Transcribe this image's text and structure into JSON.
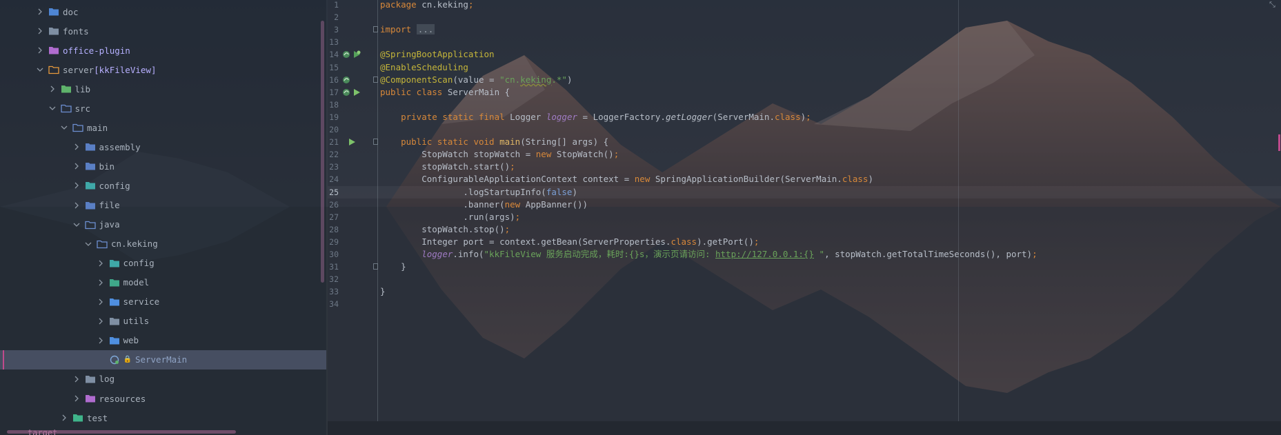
{
  "project_tree": {
    "rows": [
      {
        "label": "doc",
        "depth": 2,
        "chevron": "right",
        "icon": "folder-doc-icon",
        "color": "#4e86d4"
      },
      {
        "label": "fonts",
        "depth": 2,
        "chevron": "right",
        "icon": "folder-fonts-icon",
        "color": "#7f8fa3"
      },
      {
        "label": "office-plugin",
        "depth": 2,
        "chevron": "right",
        "icon": "folder-icon",
        "color": "#b06ccf"
      },
      {
        "label": "server",
        "module": "[kkFileView]",
        "depth": 2,
        "chevron": "down",
        "icon": "module-folder-icon",
        "color": "#e89a3c"
      },
      {
        "label": "lib",
        "depth": 3,
        "chevron": "right",
        "icon": "library-folder-icon",
        "color": "#5fb36b"
      },
      {
        "label": "src",
        "depth": 3,
        "chevron": "down",
        "icon": "source-folder-icon",
        "color": "#6d8fd1"
      },
      {
        "label": "main",
        "depth": 4,
        "chevron": "down",
        "icon": "folder-open-icon",
        "color": "#6d8fd1"
      },
      {
        "label": "assembly",
        "depth": 5,
        "chevron": "right",
        "icon": "folder-icon",
        "color": "#5a7fc4"
      },
      {
        "label": "bin",
        "depth": 5,
        "chevron": "right",
        "icon": "folder-icon",
        "color": "#5a7fc4"
      },
      {
        "label": "config",
        "depth": 5,
        "chevron": "right",
        "icon": "config-folder-icon",
        "color": "#3fa8a8"
      },
      {
        "label": "file",
        "depth": 5,
        "chevron": "right",
        "icon": "folder-icon",
        "color": "#5a7fc4"
      },
      {
        "label": "java",
        "depth": 5,
        "chevron": "down",
        "icon": "folder-open-icon",
        "color": "#6d8fd1"
      },
      {
        "label": "cn.keking",
        "depth": 6,
        "chevron": "down",
        "icon": "package-folder-icon",
        "color": "#6d8fd1"
      },
      {
        "label": "config",
        "depth": 7,
        "chevron": "right",
        "icon": "config-folder-icon",
        "color": "#3fa8a8"
      },
      {
        "label": "model",
        "depth": 7,
        "chevron": "right",
        "icon": "model-folder-icon",
        "color": "#3fa88a"
      },
      {
        "label": "service",
        "depth": 7,
        "chevron": "right",
        "icon": "service-folder-icon",
        "color": "#4f8fe0"
      },
      {
        "label": "utils",
        "depth": 7,
        "chevron": "right",
        "icon": "utils-folder-icon",
        "color": "#7f8fa3"
      },
      {
        "label": "web",
        "depth": 7,
        "chevron": "right",
        "icon": "web-folder-icon",
        "color": "#4f8fe0"
      },
      {
        "label": "ServerMain",
        "depth": 7,
        "chevron": "none",
        "icon": "java-class-icon",
        "color": "#7fa8d8",
        "selected": true,
        "locked": true
      },
      {
        "label": "log",
        "depth": 5,
        "chevron": "right",
        "icon": "log-folder-icon",
        "color": "#7f8fa3"
      },
      {
        "label": "resources",
        "depth": 5,
        "chevron": "right",
        "icon": "resources-folder-icon",
        "color": "#b06ccf"
      },
      {
        "label": "test",
        "depth": 4,
        "chevron": "right",
        "icon": "test-folder-icon",
        "color": "#3fb48a"
      }
    ],
    "cut_off_label": "target"
  },
  "editor": {
    "current_line_index": 15,
    "lines": [
      {
        "n": "1",
        "tokens": [
          [
            "kw",
            "package "
          ],
          [
            "",
            "cn.keking"
          ],
          [
            "kw",
            ";"
          ]
        ]
      },
      {
        "n": "2",
        "tokens": []
      },
      {
        "n": "3",
        "fold": true,
        "tokens": [
          [
            "kw",
            "import "
          ],
          [
            "fold-ph",
            "..."
          ]
        ]
      },
      {
        "n": "13",
        "tokens": []
      },
      {
        "n": "14",
        "gutter": [
          "bean-icon",
          "run-gutter-bean-icon"
        ],
        "tokens": [
          [
            "an",
            "@SpringBootApplication"
          ]
        ]
      },
      {
        "n": "15",
        "tokens": [
          [
            "an",
            "@EnableScheduling"
          ]
        ]
      },
      {
        "n": "16",
        "fold": true,
        "gutter": [
          "bean-icon"
        ],
        "tokens": [
          [
            "an",
            "@ComponentScan"
          ],
          [
            "",
            "(value = "
          ],
          [
            "str",
            "\"cn."
          ],
          [
            "str warnul",
            "keking"
          ],
          [
            "str",
            ".*\""
          ],
          [
            "",
            ")"
          ]
        ]
      },
      {
        "n": "17",
        "gutter": [
          "bean-icon",
          "run-icon"
        ],
        "tokens": [
          [
            "kw",
            "public class "
          ],
          [
            "",
            "ServerMain {"
          ]
        ]
      },
      {
        "n": "18",
        "tokens": []
      },
      {
        "n": "19",
        "tokens": [
          [
            "",
            "    "
          ],
          [
            "kw",
            "private static final "
          ],
          [
            "",
            "Logger "
          ],
          [
            "fld",
            "logger"
          ],
          [
            "",
            " = LoggerFactory."
          ],
          [
            "it",
            "getLogger"
          ],
          [
            "",
            "(ServerMain."
          ],
          [
            "kw",
            "class"
          ],
          [
            "",
            ")"
          ],
          [
            "kw",
            ";"
          ]
        ]
      },
      {
        "n": "20",
        "tokens": []
      },
      {
        "n": "21",
        "fold": true,
        "gutter": [
          "run-icon"
        ],
        "tokens": [
          [
            "",
            "    "
          ],
          [
            "kw",
            "public static void "
          ],
          [
            "fn",
            "main"
          ],
          [
            "",
            "(String[] args) {"
          ]
        ]
      },
      {
        "n": "22",
        "tokens": [
          [
            "",
            "        StopWatch stopWatch = "
          ],
          [
            "kw",
            "new "
          ],
          [
            "",
            "StopWatch()"
          ],
          [
            "kw",
            ";"
          ]
        ]
      },
      {
        "n": "23",
        "tokens": [
          [
            "",
            "        stopWatch.start()"
          ],
          [
            "kw",
            ";"
          ]
        ]
      },
      {
        "n": "24",
        "tokens": [
          [
            "",
            "        ConfigurableApplicationContext context = "
          ],
          [
            "kw",
            "new "
          ],
          [
            "",
            "SpringApplicationBuilder(ServerMain."
          ],
          [
            "kw",
            "class"
          ],
          [
            "",
            ")"
          ]
        ]
      },
      {
        "n": "25",
        "tokens": [
          [
            "",
            "                .logStartupInfo("
          ],
          [
            "lit",
            "false"
          ],
          [
            "",
            ")"
          ]
        ]
      },
      {
        "n": "26",
        "tokens": [
          [
            "",
            "                .banner("
          ],
          [
            "kw",
            "new "
          ],
          [
            "",
            "AppBanner())"
          ]
        ]
      },
      {
        "n": "27",
        "tokens": [
          [
            "",
            "                .run(args)"
          ],
          [
            "kw",
            ";"
          ]
        ]
      },
      {
        "n": "28",
        "tokens": [
          [
            "",
            "        stopWatch.stop()"
          ],
          [
            "kw",
            ";"
          ]
        ]
      },
      {
        "n": "29",
        "tokens": [
          [
            "",
            "        Integer port = context.getBean(ServerProperties."
          ],
          [
            "kw",
            "class"
          ],
          [
            "",
            ").getPort()"
          ],
          [
            "kw",
            ";"
          ]
        ]
      },
      {
        "n": "30",
        "tokens": [
          [
            "",
            "        "
          ],
          [
            "fld",
            "logger"
          ],
          [
            "",
            ".info("
          ],
          [
            "str",
            "\"kkFileView 服务启动完成，耗时:{}s，演示页请访问: "
          ],
          [
            "url",
            "http://127.0.0.1:{}"
          ],
          [
            "str",
            " \""
          ],
          [
            "",
            ", stopWatch.getTotalTimeSeconds(), port)"
          ],
          [
            "kw",
            ";"
          ]
        ]
      },
      {
        "n": "31",
        "fold": true,
        "tokens": [
          [
            "",
            "    }"
          ]
        ]
      },
      {
        "n": "32",
        "tokens": []
      },
      {
        "n": "33",
        "tokens": [
          [
            "",
            "}"
          ]
        ]
      },
      {
        "n": "34",
        "tokens": []
      }
    ]
  },
  "colors": {
    "keyword": "#d7883a",
    "annotation": "#c4b53a",
    "string": "#6aa35a",
    "field": "#9f7bc3",
    "method": "#e2b866",
    "selection_marker": "#c04a8c"
  }
}
